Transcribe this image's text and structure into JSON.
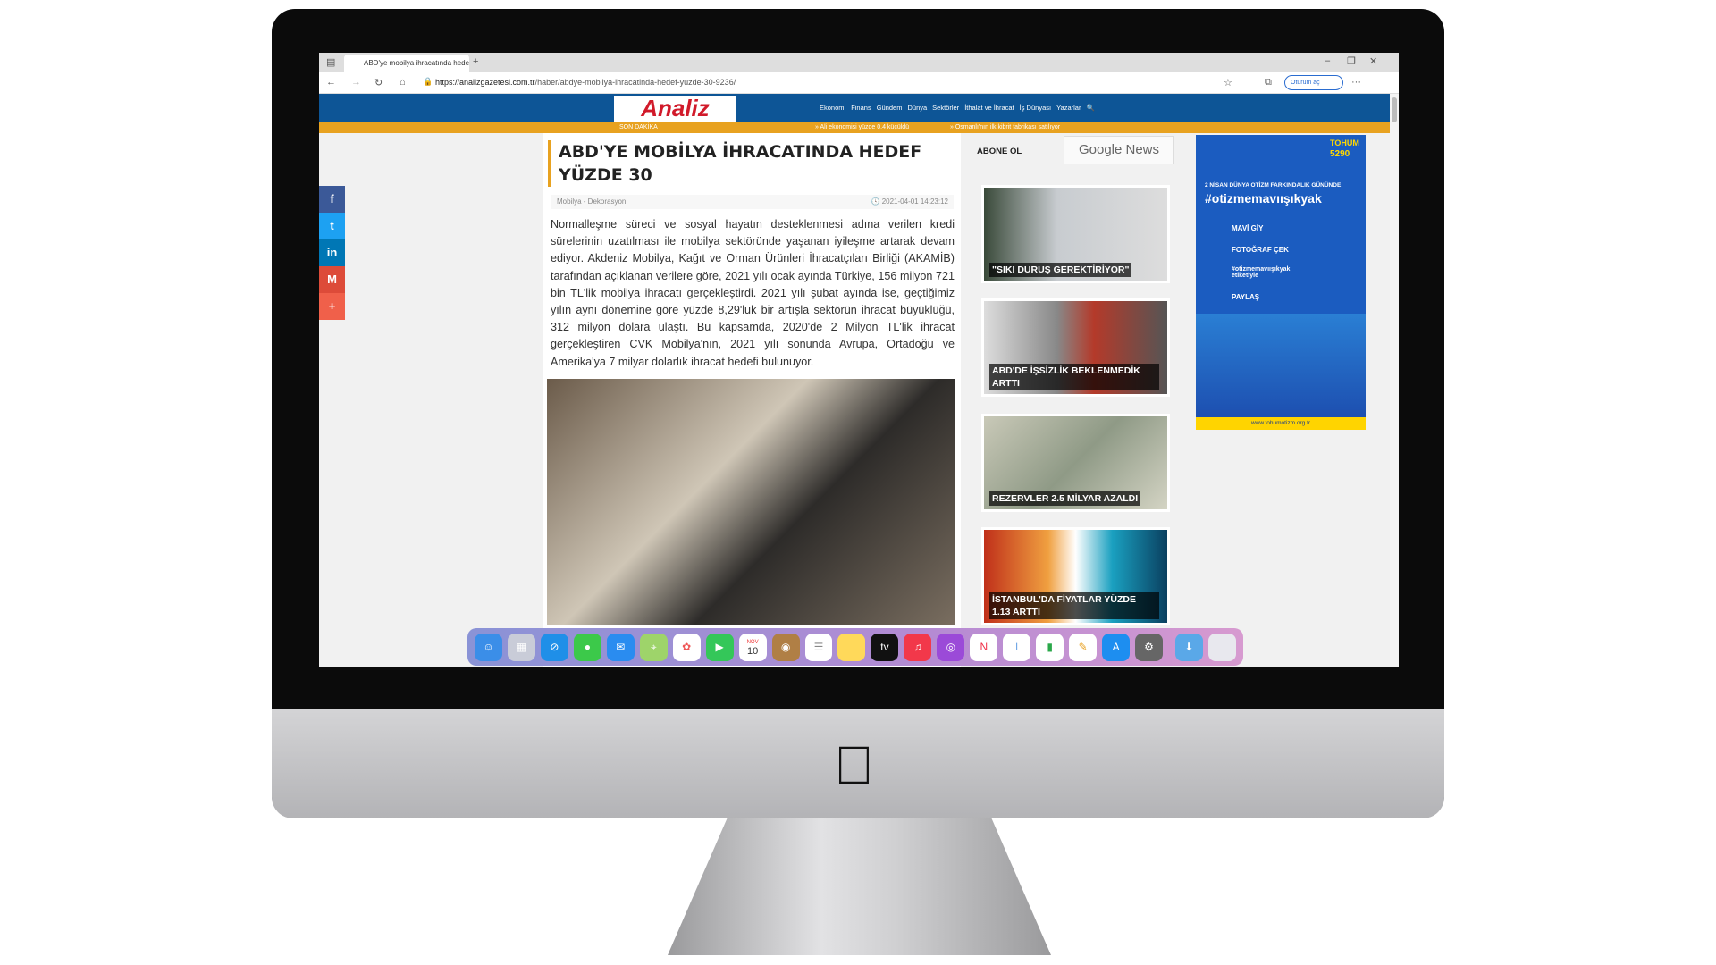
{
  "browser": {
    "tab_title": "ABD'ye mobilya ihracatında hedef",
    "url_domain": "https://analizgazetesi.com.tr",
    "url_path": "/haber/abdye-mobilya-ihracatinda-hedef-yuzde-30-9236/",
    "signin": "Oturum aç"
  },
  "site": {
    "logo": "Analiz",
    "nav": [
      "Ekonomi",
      "Finans",
      "Gündem",
      "Dünya",
      "Sektörler",
      "İthalat ve İhracat",
      "İş Dünyası",
      "Yazarlar"
    ],
    "ticker_label": "SON DAKİKA",
    "ticker": [
      "» Ali ekonomisi yüzde 0.4 küçüldü",
      "» Osmanlı'nın ilk kibrit fabrikası satılıyor"
    ]
  },
  "social": [
    "f",
    "t",
    "in",
    "M",
    "+"
  ],
  "article": {
    "title": "ABD'YE MOBİLYA İHRACATINDA HEDEF YÜZDE 30",
    "category": "Mobilya - Dekorasyon",
    "date": "2021-04-01 14:23:12",
    "body": "Normalleşme süreci ve sosyal hayatın desteklenmesi adına verilen kredi sürelerinin uzatılması ile mobilya sektöründe yaşanan iyileşme artarak devam ediyor. Akdeniz Mobilya, Kağıt ve Orman Ürünleri İhracatçıları Birliği (AKAMİB) tarafından açıklanan verilere göre, 2021 yılı ocak ayında Türkiye, 156 milyon 721 bin TL'lik mobilya ihracatı gerçekleştirdi. 2021 yılı şubat ayında ise, geçtiğimiz yılın aynı dönemine göre yüzde 8,29'luk bir artışla sektörün ihracat büyüklüğü, 312 milyon dolara ulaştı. Bu kapsamda, 2020'de 2 Milyon TL'lik ihracat gerçekleştiren CVK Mobilya'nın, 2021 yılı sonunda Avrupa, Ortadoğu ve Amerika'ya 7 milyar dolarlık ihracat hedefi bulunuyor."
  },
  "sidebar": {
    "subscribe": "ABONE OL",
    "google_news": "Google News",
    "cards": [
      "\"SIKI DURUŞ GEREKTİRİYOR\"",
      "ABD'DE İŞSİZLİK BEKLENMEDİK ARTTI",
      "REZERVLER 2.5 MİLYAR AZALDI",
      "İSTANBUL'DA FİYATLAR YÜZDE 1.13 ARTTI"
    ]
  },
  "ad": {
    "brand": "TOHUM",
    "sms": "5290",
    "date_line": "2 NİSAN DÜNYA OTİZM FARKINDALIK GÜNÜNDE",
    "hashtag": "#otizmemavıışıkyak",
    "steps": [
      "MAVİ GİY",
      "FOTOĞRAF ÇEK",
      "#otizmemavıışıkyak etiketiyle",
      "PAYLAŞ"
    ],
    "site": "www.tohumotizm.org.tr"
  },
  "dock": {
    "calendar_month": "NOV",
    "calendar_day": "10",
    "apps": [
      "finder",
      "launchpad",
      "safari",
      "messages",
      "mail",
      "maps",
      "photos",
      "facetime",
      "calendar",
      "contacts",
      "reminders",
      "notes",
      "tv",
      "music",
      "podcasts",
      "news",
      "keynote",
      "numbers",
      "pages",
      "app-store",
      "system-preferences",
      "downloads",
      "trash"
    ]
  }
}
